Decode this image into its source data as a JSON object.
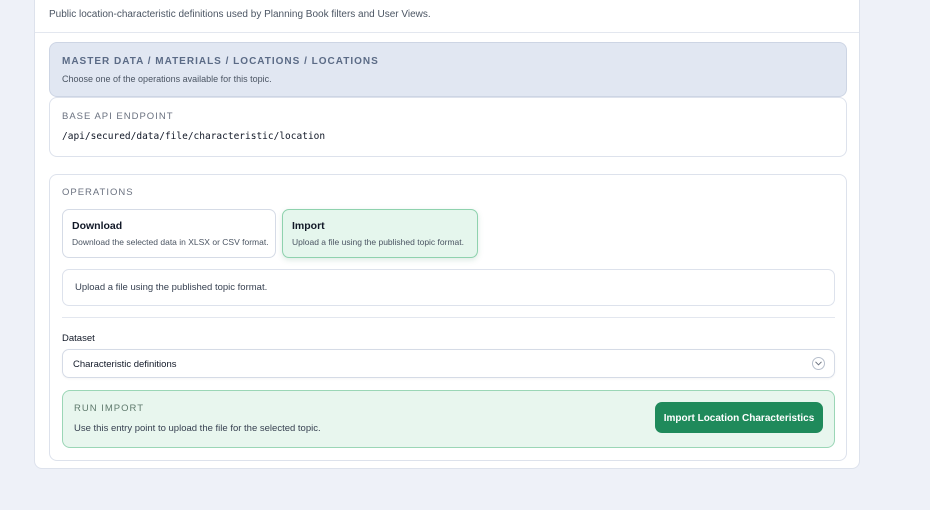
{
  "intro": {
    "text": "Public location-characteristic definitions used by Planning Book filters and User Views."
  },
  "topic": {
    "breadcrumb": "MASTER DATA / MATERIALS / LOCATIONS / LOCATIONS",
    "subtitle": "Choose one of the operations available for this topic."
  },
  "api": {
    "label": "BASE API ENDPOINT",
    "path": "/api/secured/data/file/characteristic/location"
  },
  "operations": {
    "label": "OPERATIONS",
    "items": [
      {
        "title": "Download",
        "description": "Download the selected data in XLSX or CSV format.",
        "selected": false
      },
      {
        "title": "Import",
        "description": "Upload a file using the published topic format.",
        "selected": true
      }
    ],
    "info": "Upload a file using the published topic format."
  },
  "dataset": {
    "label": "Dataset",
    "value": "Characteristic definitions"
  },
  "run": {
    "label": "RUN IMPORT",
    "description": "Use this entry point to upload the file for the selected topic.",
    "button_label": "Import Location Characteristics"
  },
  "colors": {
    "accent": "#1f8a5b",
    "selected_bg": "#e5f6ed",
    "topic_bg": "#e1e7f2"
  }
}
